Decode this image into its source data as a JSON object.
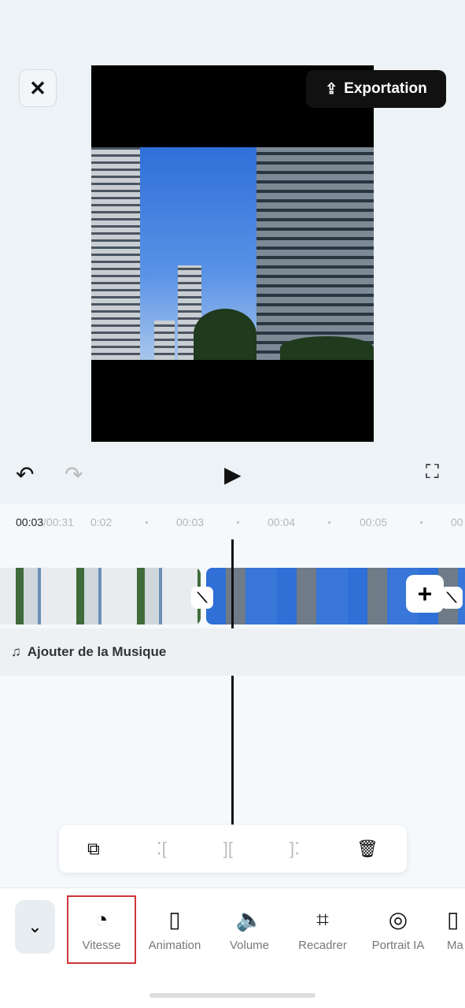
{
  "header": {
    "close_icon": "close-icon",
    "export_label": "Exportation",
    "export_icon": "upload-icon"
  },
  "playback": {
    "undo_icon": "undo-icon",
    "redo_icon": "redo-icon",
    "play_icon": "play-icon",
    "fullscreen_icon": "fullscreen-icon"
  },
  "timeline": {
    "current_time": "00:03",
    "total_time": "/00:31",
    "ticks": [
      "0:02",
      "00:03",
      "00:04",
      "00:05",
      "00"
    ]
  },
  "music": {
    "label": "Ajouter de la Musique",
    "icon": "music-add-icon"
  },
  "edit_toolbar": [
    "duplicate-icon",
    "split-left-icon",
    "split-icon",
    "split-right-icon",
    "delete-icon"
  ],
  "tools": [
    {
      "label": "Vitesse",
      "icon": "speed-icon",
      "selected": true
    },
    {
      "label": "Animation",
      "icon": "animation-icon"
    },
    {
      "label": "Volume",
      "icon": "volume-icon"
    },
    {
      "label": "Recadrer",
      "icon": "crop-icon"
    },
    {
      "label": "Portrait IA",
      "icon": "portrait-icon"
    },
    {
      "label": "Ma",
      "icon": "mask-icon"
    }
  ],
  "colors": {
    "selection": "#d0343a"
  }
}
